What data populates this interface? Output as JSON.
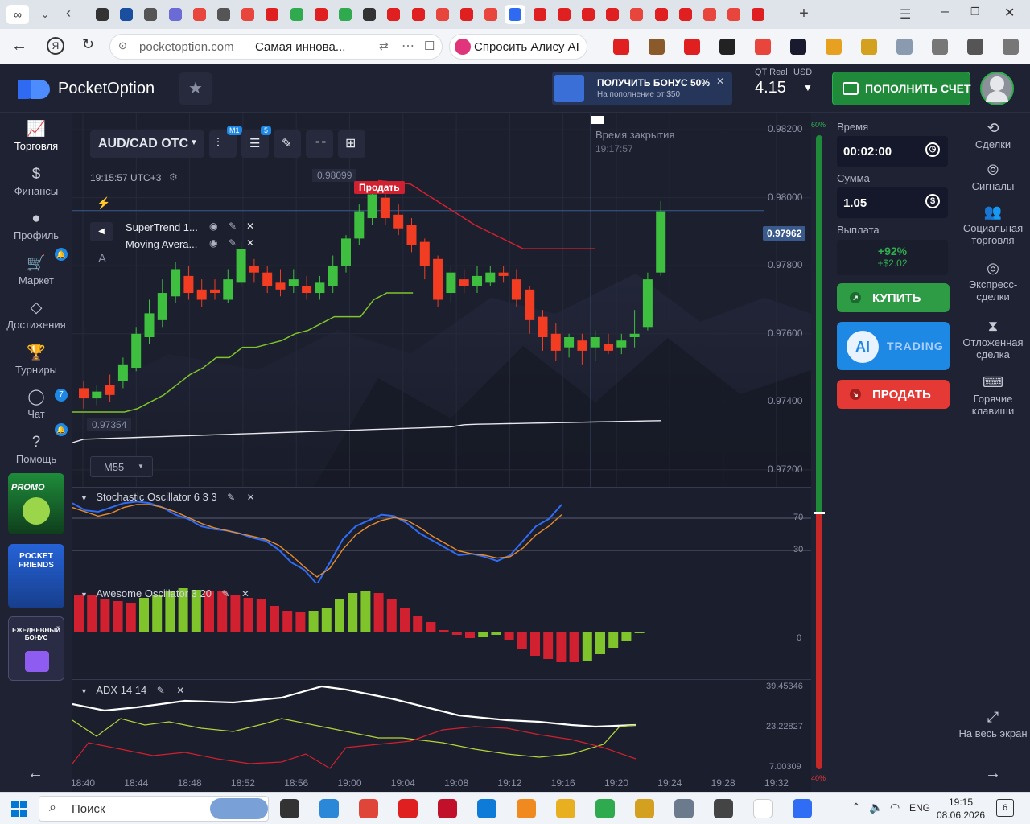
{
  "browser": {
    "url": "pocketoption.com",
    "page_title": "Самая инновa...",
    "alice_label": "Спросить Алису AI"
  },
  "header": {
    "brand": "PocketOption",
    "bonus_title": "ПОЛУЧИТЬ БОНУС 50%",
    "bonus_sub": "На пополнение от $50",
    "account_label": "QT Real",
    "currency": "USD",
    "balance": "4.15",
    "deposit_label": "ПОПОЛНИТЬ СЧЕТ"
  },
  "leftnav": [
    {
      "label": "Торговля",
      "icon": "chart-icon"
    },
    {
      "label": "Финансы",
      "icon": "dollar-icon"
    },
    {
      "label": "Профиль",
      "icon": "user-icon"
    },
    {
      "label": "Маркет",
      "icon": "cart-icon"
    },
    {
      "label": "Достижения",
      "icon": "diamond-icon"
    },
    {
      "label": "Турниры",
      "icon": "trophy-icon"
    },
    {
      "label": "Чат",
      "icon": "chat-icon",
      "badge": "7"
    },
    {
      "label": "Помощь",
      "icon": "help-icon"
    }
  ],
  "promos": {
    "promo": "PROMO",
    "friends_1": "POCKET",
    "friends_2": "FRIENDS",
    "daily_1": "ЕЖЕДНЕВНЫЙ",
    "daily_2": "БОНУС"
  },
  "chart": {
    "asset": "AUD/CAD OTC",
    "timeframe_badge": "M1",
    "indicators_badge": "5",
    "server_time": "19:15:57 UTC+3",
    "close_label": "Время закрытия",
    "close_time": "19:17:57",
    "high_label": "0.98099",
    "low_label": "0.97354",
    "sell_marker": "Продать",
    "current_price": "0.97962",
    "timeframe": "M55",
    "indicators": [
      "SuperTrend 1...",
      "Moving Avera..."
    ],
    "price_ticks": [
      "0.98200",
      "0.98000",
      "0.97800",
      "0.97600",
      "0.97400",
      "0.97200"
    ],
    "panels": {
      "stoch": {
        "title": "Stochastic Oscillator  6 3 3",
        "levels": [
          "70",
          "30"
        ]
      },
      "ao": {
        "title": "Awesome Oscillator  3 20",
        "levels": [
          "0"
        ]
      },
      "adx": {
        "title": "ADX  14 14",
        "levels": [
          "39.45346",
          "23.22827",
          "7.00309"
        ]
      }
    },
    "time_ticks": [
      "18:40",
      "18:44",
      "18:48",
      "18:52",
      "18:56",
      "19:00",
      "19:04",
      "19:08",
      "19:12",
      "19:16",
      "19:20",
      "19:24",
      "19:28",
      "19:32"
    ],
    "sentiment_top": "60%",
    "sentiment_bottom": "40%"
  },
  "chart_data": {
    "type": "candlestick",
    "ylim": [
      0.9715,
      0.9825
    ],
    "candles": [
      [
        0.9744,
        0.9741,
        0.9746,
        0.9738
      ],
      [
        0.9741,
        0.9743,
        0.9745,
        0.9739
      ],
      [
        0.9745,
        0.9742,
        0.9748,
        0.974
      ],
      [
        0.9746,
        0.9751,
        0.9753,
        0.9744
      ],
      [
        0.975,
        0.976,
        0.9762,
        0.9749
      ],
      [
        0.9759,
        0.9766,
        0.977,
        0.9757
      ],
      [
        0.9764,
        0.9772,
        0.9776,
        0.9762
      ],
      [
        0.9771,
        0.9779,
        0.9781,
        0.9769
      ],
      [
        0.9777,
        0.9772,
        0.978,
        0.977
      ],
      [
        0.9773,
        0.977,
        0.9776,
        0.9768
      ],
      [
        0.9773,
        0.9772,
        0.9776,
        0.977
      ],
      [
        0.977,
        0.9776,
        0.9779,
        0.9769
      ],
      [
        0.9775,
        0.9785,
        0.9787,
        0.9774
      ],
      [
        0.978,
        0.9778,
        0.9782,
        0.9775
      ],
      [
        0.9778,
        0.9774,
        0.978,
        0.9772
      ],
      [
        0.9775,
        0.9773,
        0.9779,
        0.9771
      ],
      [
        0.9774,
        0.9776,
        0.9779,
        0.9772
      ],
      [
        0.9774,
        0.9772,
        0.9777,
        0.977
      ],
      [
        0.9772,
        0.9775,
        0.9777,
        0.977
      ],
      [
        0.9774,
        0.978,
        0.9783,
        0.9772
      ],
      [
        0.978,
        0.9788,
        0.9789,
        0.9778
      ],
      [
        0.9788,
        0.9796,
        0.9798,
        0.9786
      ],
      [
        0.9794,
        0.9801,
        0.9804,
        0.9792
      ],
      [
        0.98,
        0.9794,
        0.9805,
        0.9792
      ],
      [
        0.9795,
        0.9791,
        0.9798,
        0.9789
      ],
      [
        0.9792,
        0.9786,
        0.9794,
        0.9784
      ],
      [
        0.9787,
        0.978,
        0.9788,
        0.9776
      ],
      [
        0.9782,
        0.977,
        0.9783,
        0.9768
      ],
      [
        0.9772,
        0.9778,
        0.978,
        0.9769
      ],
      [
        0.9776,
        0.9774,
        0.9779,
        0.9772
      ],
      [
        0.9774,
        0.9777,
        0.978,
        0.9772
      ],
      [
        0.9775,
        0.9778,
        0.978,
        0.9774
      ],
      [
        0.9778,
        0.9777,
        0.978,
        0.9775
      ],
      [
        0.9776,
        0.977,
        0.9779,
        0.9768
      ],
      [
        0.9773,
        0.9764,
        0.9774,
        0.976
      ],
      [
        0.9765,
        0.9759,
        0.9767,
        0.9755
      ],
      [
        0.976,
        0.9755,
        0.9763,
        0.9752
      ],
      [
        0.9756,
        0.9759,
        0.976,
        0.9753
      ],
      [
        0.9758,
        0.9755,
        0.976,
        0.9751
      ],
      [
        0.9756,
        0.9759,
        0.9761,
        0.9752
      ],
      [
        0.9757,
        0.9755,
        0.976,
        0.9754
      ],
      [
        0.9756,
        0.9758,
        0.976,
        0.9754
      ],
      [
        0.9759,
        0.976,
        0.9767,
        0.9756
      ],
      [
        0.9762,
        0.9776,
        0.9778,
        0.9761
      ],
      [
        0.9778,
        0.9796,
        0.9799,
        0.9777
      ]
    ]
  },
  "trade": {
    "time_label": "Время",
    "time_value": "00:02:00",
    "amount_label": "Сумма",
    "amount_value": "1.05",
    "payout_label": "Выплата",
    "payout_pct": "+92%",
    "payout_value": "+$2.02",
    "buy_label": "КУПИТЬ",
    "ai_label": "AI",
    "ai_trading": "TRADING",
    "sell_label": "ПРОДАТЬ"
  },
  "rightnav": [
    {
      "label": "Сделки",
      "icon": "history-icon"
    },
    {
      "label": "Сигналы",
      "icon": "signal-icon"
    },
    {
      "label": "Социальная торговля",
      "icon": "people-icon"
    },
    {
      "label": "Экспресс-сделки",
      "icon": "target-icon"
    },
    {
      "label": "Отложенная сделка",
      "icon": "hourglass-icon"
    },
    {
      "label": "Горячие клавиши",
      "icon": "keyboard-icon"
    },
    {
      "label": "На весь экран",
      "icon": "fullscreen-icon"
    }
  ],
  "taskbar": {
    "search": "Поиск",
    "lang": "ENG",
    "time": "19:15",
    "date": "08.06.2026",
    "notif": "6"
  }
}
